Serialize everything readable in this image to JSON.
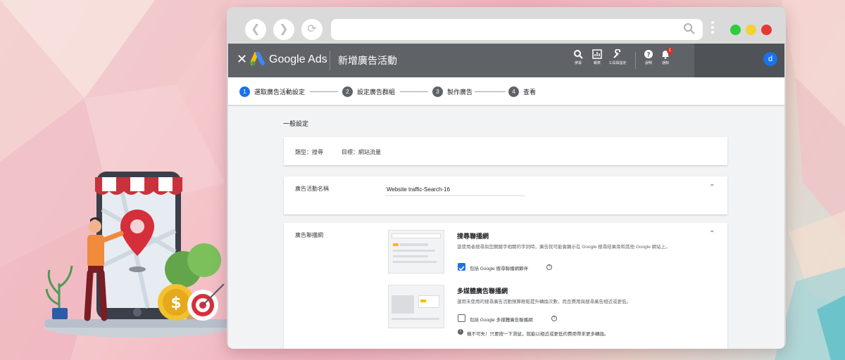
{
  "browser": {
    "back_icon": "arrow-left-icon",
    "forward_icon": "arrow-right-icon",
    "reload_icon": "reload-icon",
    "search_icon": "search-icon",
    "traffic_lights": [
      "#2ecc40",
      "#f5d131",
      "#e53935"
    ]
  },
  "header": {
    "brand": "Google Ads",
    "page_title": "新增廣告活動",
    "tools": [
      {
        "icon": "search-icon",
        "label": "搜尋"
      },
      {
        "icon": "report-icon",
        "label": "報表"
      },
      {
        "icon": "wrench-icon",
        "label": "工具與設定"
      },
      {
        "icon": "help-icon",
        "label": "說明"
      },
      {
        "icon": "bell-icon",
        "label": "通知"
      }
    ],
    "notification_count": "1",
    "avatar_letter": "d"
  },
  "stepper": {
    "steps": [
      {
        "num": "1",
        "label": "選取廣告活動設定"
      },
      {
        "num": "2",
        "label": "設定廣告群組"
      },
      {
        "num": "3",
        "label": "製作廣告"
      },
      {
        "num": "4",
        "label": "查看"
      }
    ]
  },
  "general": {
    "title": "一般設定",
    "type_label": "類型：搜尋",
    "goal_label": "目標：網站流量"
  },
  "campaign_name": {
    "label": "廣告活動名稱",
    "value": "Website traffic-Search-16"
  },
  "networks": {
    "label": "廣告聯播網",
    "search": {
      "title": "搜尋聯播網",
      "desc": "當使用者搜尋與您關鍵字相關的字詞時，廣告就可能會顯示在 Google 搜尋結果旁和其他 Google 網站上。",
      "checkbox": "包括 Google 搜尋聯播網夥伴",
      "checked": true
    },
    "display": {
      "title": "多媒體廣告聯播網",
      "desc": "運用未使用的搜尋廣告活動預算輕鬆提升轉換次數，而且費用與搜尋廣告相近或更低。",
      "checkbox": "包括 Google 多媒體廣告聯播網",
      "checked": false,
      "warning": "機不可失！只要按一下滑鼠，就能以相近或更低的費用帶來更多轉換。"
    }
  },
  "colors": {
    "header_bg": "#5f6368",
    "accent": "#1a73e8"
  }
}
